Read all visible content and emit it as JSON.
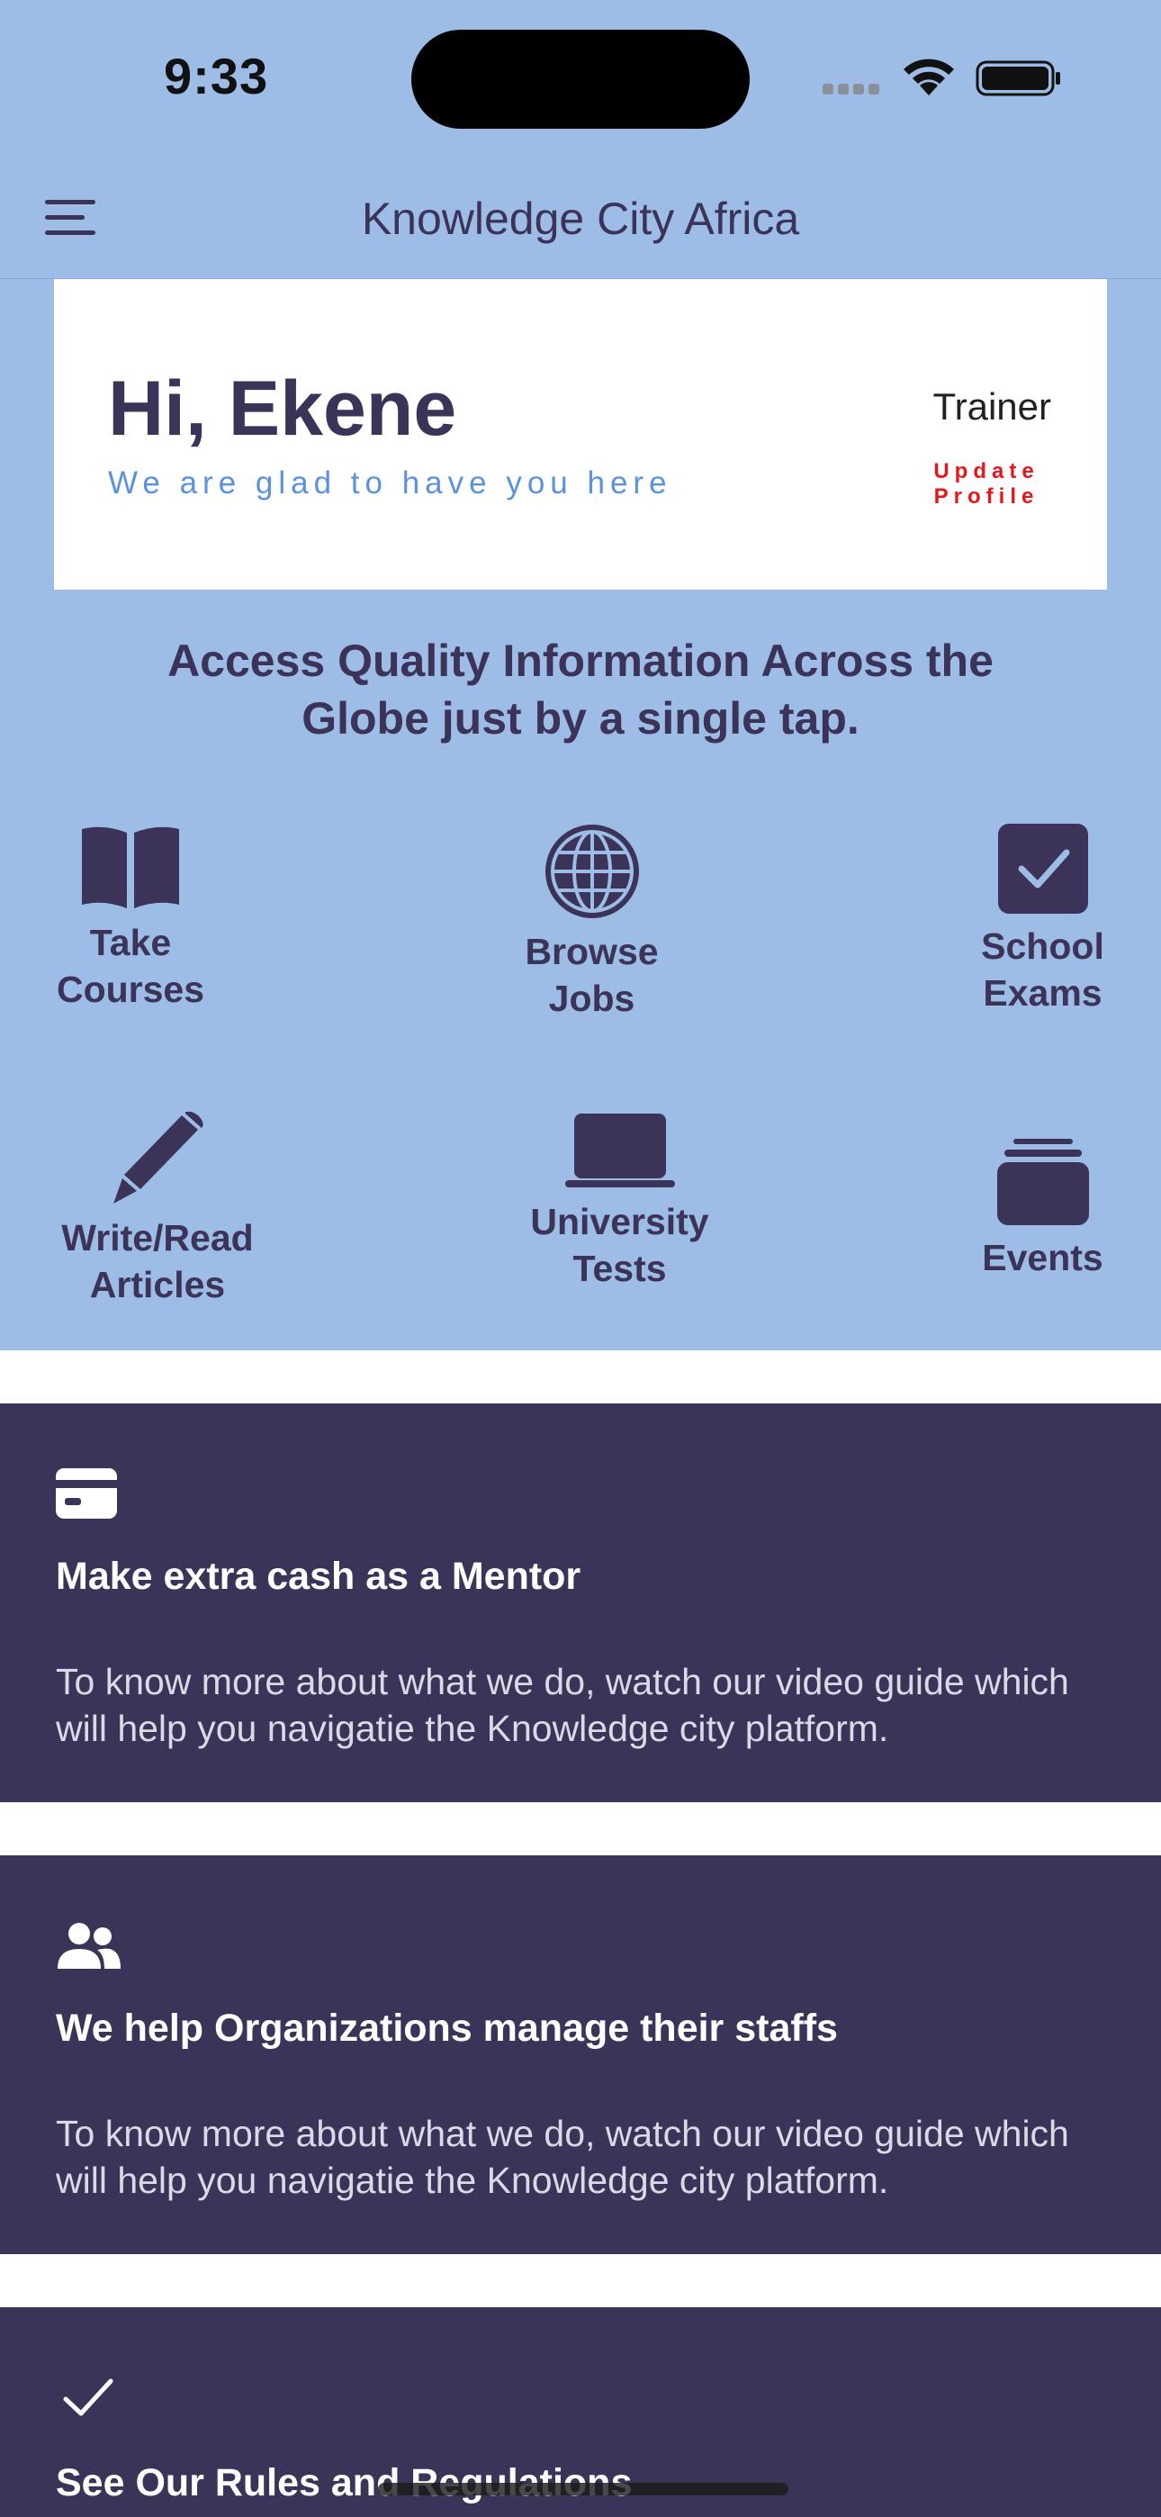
{
  "status_bar": {
    "time": "9:33"
  },
  "header": {
    "title": "Knowledge City Africa"
  },
  "welcome": {
    "greeting": "Hi, Ekene",
    "subtitle": "We are glad to have you here",
    "role": "Trainer",
    "update_line1": "Update",
    "update_line2": "Profile"
  },
  "tagline": {
    "line1": "Access Quality Information Across the",
    "line2": "Globe just by a single tap."
  },
  "features": [
    {
      "line1": "Take",
      "line2": "Courses",
      "icon": "book-icon"
    },
    {
      "line1": "Browse",
      "line2": "Jobs",
      "icon": "globe-icon"
    },
    {
      "line1": "School",
      "line2": "Exams",
      "icon": "checkbox-icon"
    },
    {
      "line1": "Write/Read",
      "line2": "Articles",
      "icon": "pencil-icon"
    },
    {
      "line1": "University",
      "line2": "Tests",
      "icon": "laptop-icon"
    },
    {
      "line1": "Events",
      "icon": "stack-icon"
    }
  ],
  "cards": [
    {
      "icon": "credit-card-icon",
      "title": "Make extra cash as a Mentor",
      "desc1": "To know more about what we do, watch our video guide which",
      "desc2": "will help you navigatie the Knowledge city platform."
    },
    {
      "icon": "people-icon",
      "title": "We help Organizations manage their staffs",
      "desc1": "To know more about what we do, watch our video guide which",
      "desc2": "will help you navigatie the Knowledge city platform."
    },
    {
      "icon": "checkmark-icon",
      "title": "See Our Rules and Regulations"
    }
  ],
  "colors": {
    "hero_background": "#9dbde6",
    "primary_dark": "#3b3358",
    "link_red": "#e8161b",
    "subtitle_blue": "#5b92e0"
  }
}
